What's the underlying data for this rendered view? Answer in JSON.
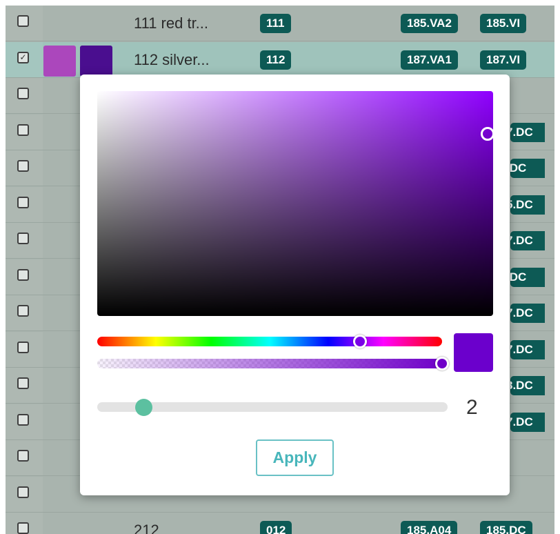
{
  "rows": [
    {
      "checked": false,
      "name": "111 red tr...",
      "code": "111",
      "tags": [
        "185.VA2",
        "185.VI"
      ]
    },
    {
      "checked": true,
      "name": "112 silver...",
      "code": "112",
      "tags": [
        "187.VA1",
        "187.VI"
      ],
      "swatches": [
        "#ab47bc",
        "#4a0e8f"
      ]
    },
    {
      "checked": false
    },
    {
      "checked": false,
      "tag_fragment": "7.DC"
    },
    {
      "checked": false,
      "tag_fragment": ".DC"
    },
    {
      "checked": false,
      "tag_fragment": "5.DC"
    },
    {
      "checked": false,
      "tag_fragment": "7.DC"
    },
    {
      "checked": false,
      "tag_fragment": ".DC"
    },
    {
      "checked": false,
      "tag_fragment": "7.DC"
    },
    {
      "checked": false,
      "tag_fragment": "7.DC"
    },
    {
      "checked": false,
      "tag_fragment": "3.DC"
    },
    {
      "checked": false,
      "tag_fragment": "7.DC"
    },
    {
      "checked": false
    },
    {
      "checked": false
    },
    {
      "checked": false,
      "name": "212",
      "code": "012",
      "tags": [
        "185.A04",
        "185.DC"
      ]
    }
  ],
  "picker": {
    "hue_color": "#8f00ff",
    "selected_color": "#6b00cc",
    "size_value": "2",
    "apply_label": "Apply"
  },
  "colors": {
    "badge_bg": "#0d5a55",
    "table_bg": "#a9b4ae",
    "selected_row_bg": "#9fc3bb",
    "accent": "#5cc0a0"
  },
  "checkmark": "✓"
}
